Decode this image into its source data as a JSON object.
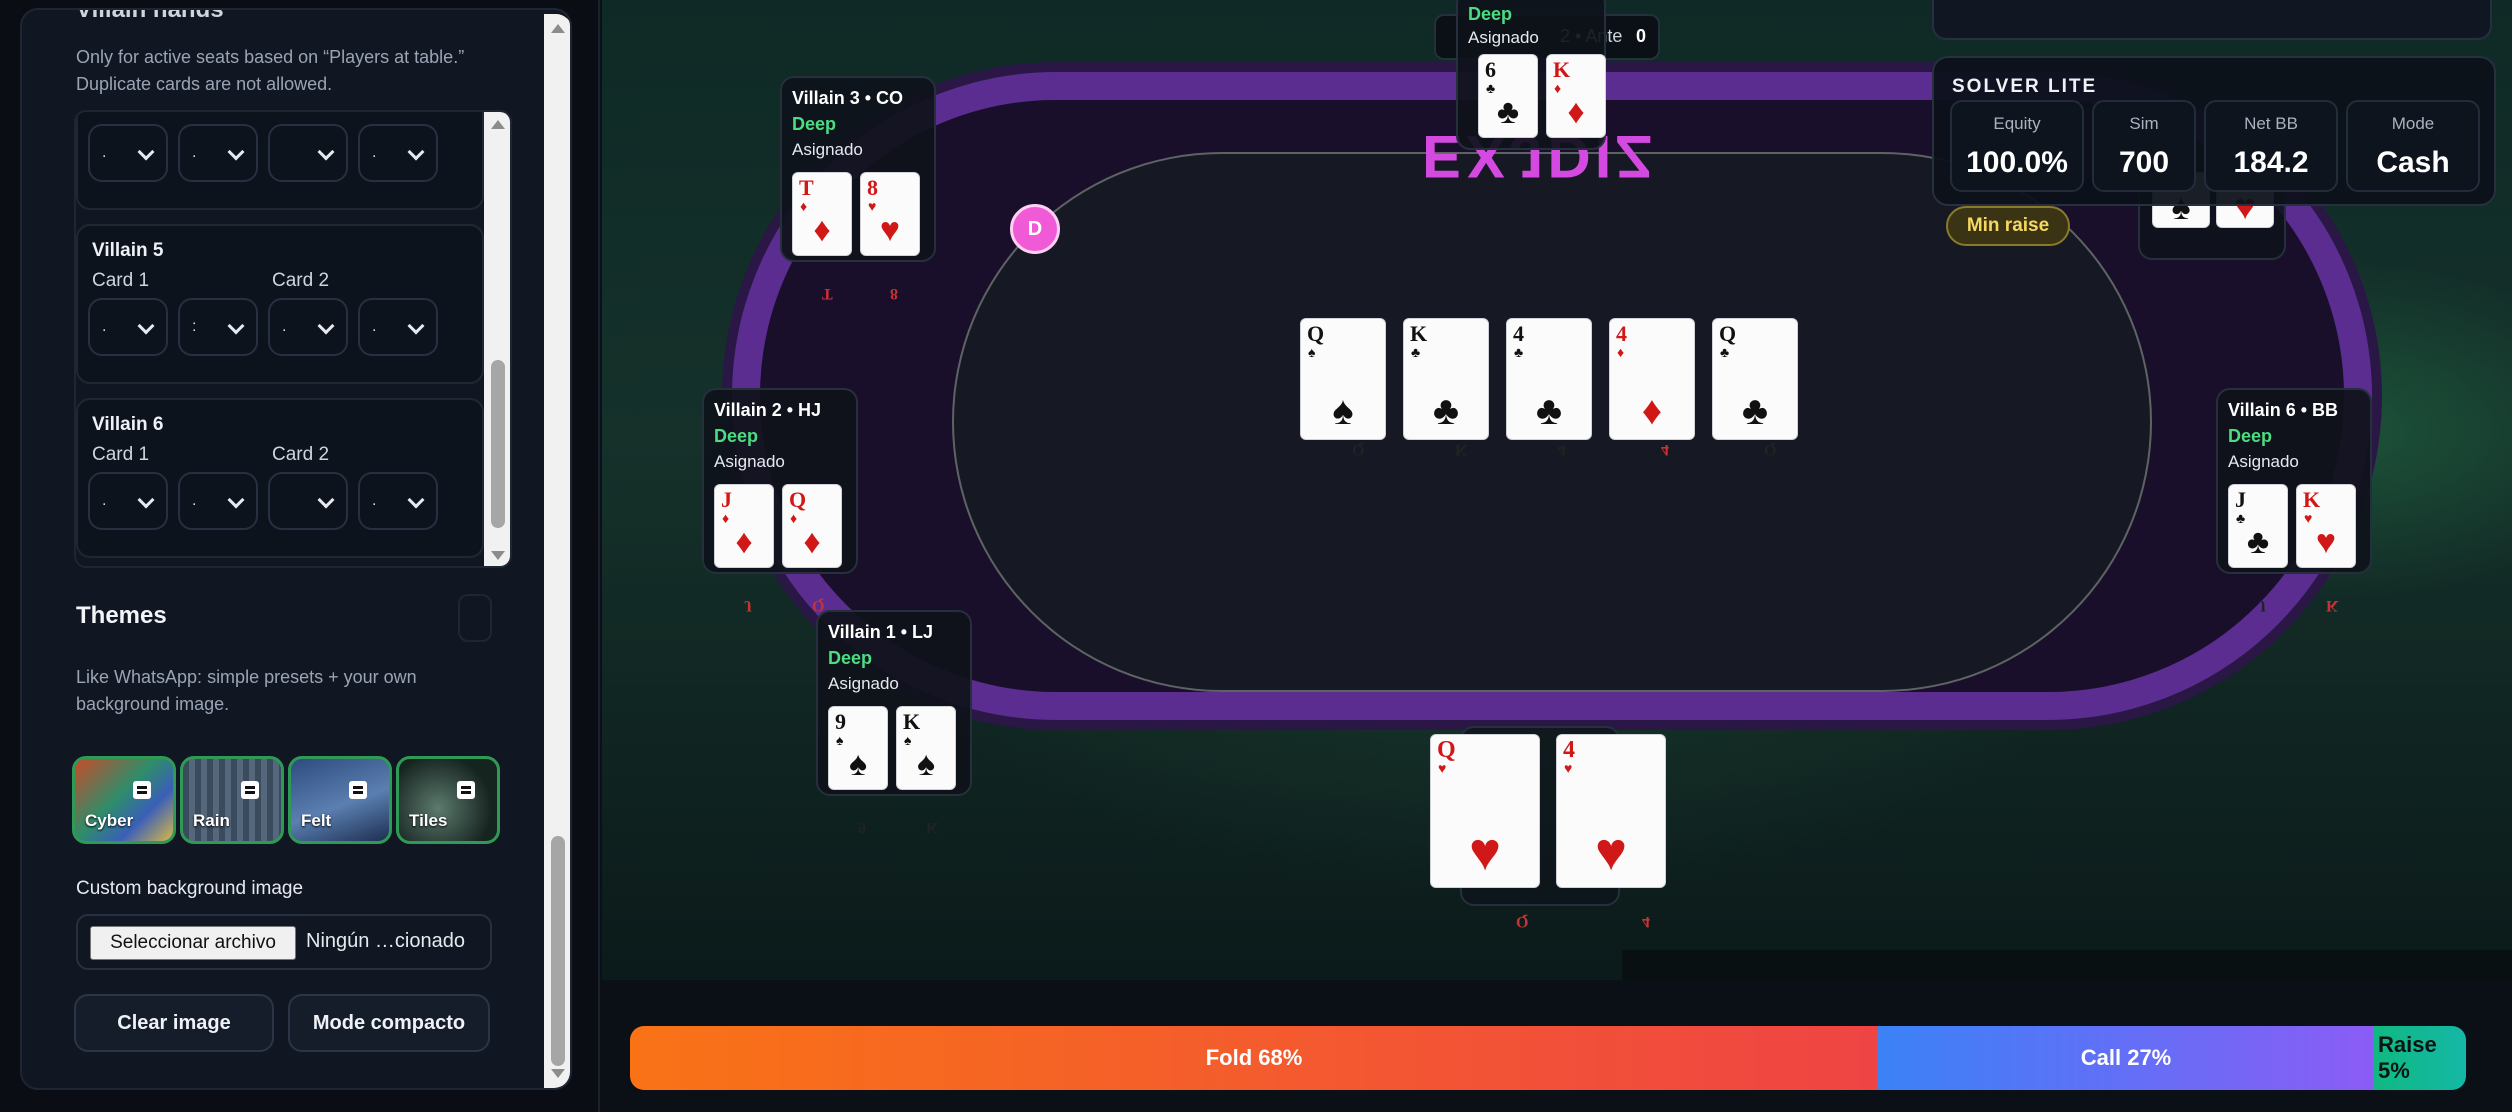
{
  "sidebar": {
    "section_title": "Villain hands",
    "hint": "Only for active seats based on “Players at table.” Duplicate cards are not allowed.",
    "villains": [
      {
        "name": "",
        "card1_label": "Card 1",
        "card2_label": "Card 2",
        "values": [
          ".",
          ".",
          "",
          "."
        ]
      },
      {
        "name": "Villain 5",
        "card1_label": "Card 1",
        "card2_label": "Card 2",
        "values": [
          ".",
          ":",
          ".",
          "."
        ]
      },
      {
        "name": "Villain 6",
        "card1_label": "Card 1",
        "card2_label": "Card 2",
        "values": [
          ".",
          ".",
          "",
          "."
        ]
      }
    ],
    "themes": {
      "title": "Themes",
      "description": "Like WhatsApp: simple presets + your own background image.",
      "presets": [
        "Cyber",
        "Rain",
        "Felt",
        "Tiles"
      ]
    },
    "custom_bg": {
      "label": "Custom background image",
      "button": "Seleccionar archivo",
      "file_name": "Ningún …cionado"
    },
    "buttons": {
      "clear": "Clear image",
      "compact": "Mode compacto"
    }
  },
  "table": {
    "logo": "EXJDIZ",
    "dealer": "D",
    "top_strip": {
      "text": "2 • Ante",
      "value": "0"
    },
    "solver": {
      "title": "SOLVER LITE",
      "stats": [
        {
          "label": "Equity",
          "value": "100.0%"
        },
        {
          "label": "Sim",
          "value": "700"
        },
        {
          "label": "Net BB",
          "value": "184.2"
        },
        {
          "label": "Mode",
          "value": "Cash"
        }
      ],
      "min_raise": "Min raise"
    },
    "board": [
      {
        "rank": "Q",
        "suit": "♠",
        "color": "#111111"
      },
      {
        "rank": "K",
        "suit": "♣",
        "color": "#111111"
      },
      {
        "rank": "4",
        "suit": "♣",
        "color": "#111111"
      },
      {
        "rank": "4",
        "suit": "♦",
        "color": "#d01818"
      },
      {
        "rank": "Q",
        "suit": "♣",
        "color": "#111111"
      }
    ],
    "seats": [
      {
        "name": "Villain 3 • CO",
        "depth": "Deep",
        "status": "Asignado",
        "cards": [
          {
            "rank": "T",
            "suit": "♦",
            "color": "#d01818"
          },
          {
            "rank": "8",
            "suit": "♥",
            "color": "#d01818"
          }
        ]
      },
      {
        "name": "Villain 2 • HJ",
        "depth": "Deep",
        "status": "Asignado",
        "cards": [
          {
            "rank": "J",
            "suit": "♦",
            "color": "#d01818"
          },
          {
            "rank": "Q",
            "suit": "♦",
            "color": "#d01818"
          }
        ]
      },
      {
        "name": "Villain 1 • LJ",
        "depth": "Deep",
        "status": "Asignado",
        "cards": [
          {
            "rank": "9",
            "suit": "♠",
            "color": "#111111"
          },
          {
            "rank": "K",
            "suit": "♠",
            "color": "#111111"
          }
        ]
      },
      {
        "name": "Villain 6 • BB",
        "depth": "Deep",
        "status": "Asignado",
        "cards": [
          {
            "rank": "J",
            "suit": "♣",
            "color": "#111111"
          },
          {
            "rank": "K",
            "suit": "♥",
            "color": "#d01818"
          }
        ]
      },
      {
        "name": "",
        "depth": "Deep",
        "status": "Asignado",
        "cards": [
          {
            "rank": "6",
            "suit": "♣",
            "color": "#111111"
          },
          {
            "rank": "K",
            "suit": "♦",
            "color": "#d01818"
          }
        ]
      }
    ],
    "hero": [
      {
        "rank": "Q",
        "suit": "♥",
        "color": "#d01818"
      },
      {
        "rank": "4",
        "suit": "♥",
        "color": "#d01818"
      }
    ]
  },
  "actions": {
    "fold": {
      "label": "Fold 68%",
      "pct": 68
    },
    "call": {
      "label": "Call 27%",
      "pct": 27
    },
    "raise": {
      "label": "Raise 5%",
      "pct": 5
    }
  }
}
